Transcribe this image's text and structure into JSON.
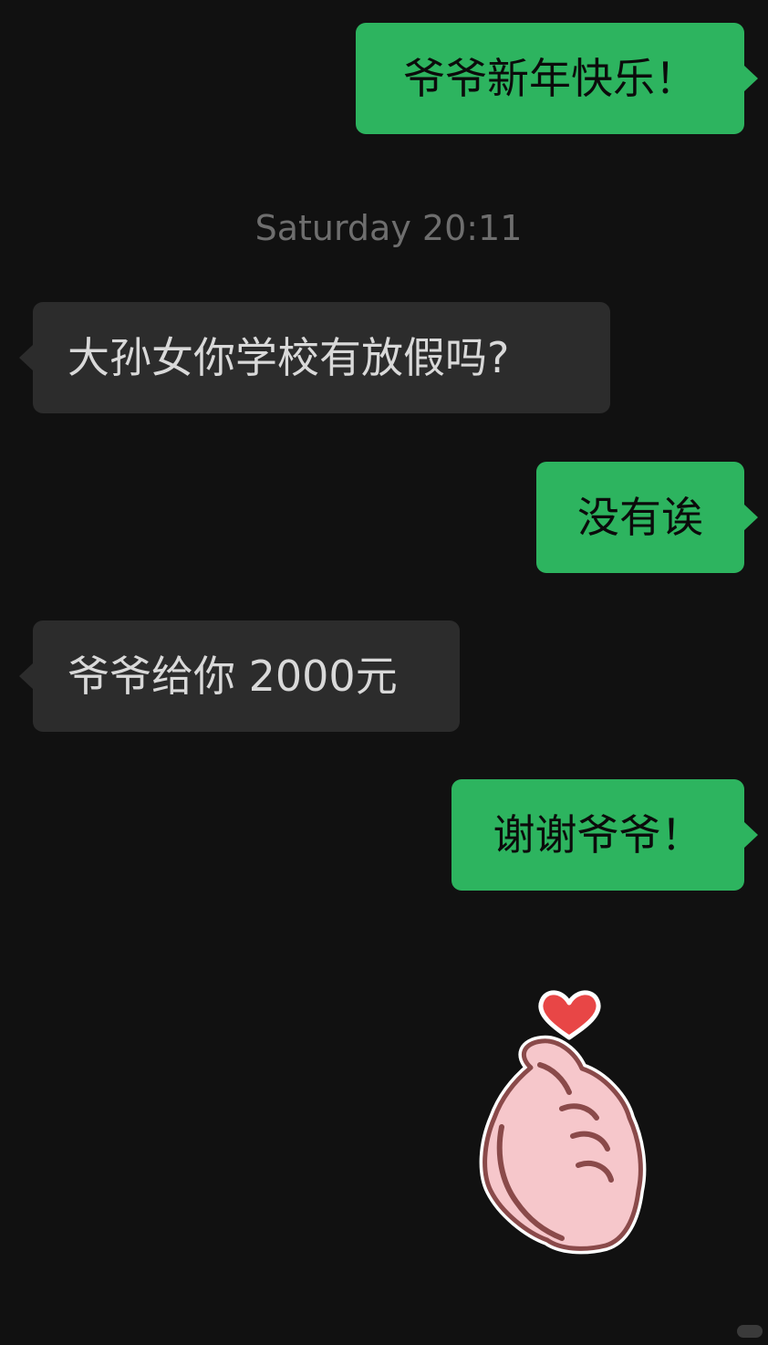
{
  "chat": {
    "timestamp": "Saturday 20:11",
    "messages": [
      {
        "direction": "outgoing",
        "text": "爷爷新年快乐！"
      },
      {
        "direction": "incoming",
        "text": "大孙女你学校有放假吗?"
      },
      {
        "direction": "outgoing",
        "text": "没有诶"
      },
      {
        "direction": "incoming",
        "text": "爷爷给你 2000元"
      },
      {
        "direction": "outgoing",
        "text": "谢谢爷爷！"
      }
    ],
    "sticker": {
      "icon": "finger-heart-icon"
    }
  },
  "colors": {
    "background": "#111111",
    "outgoing_bubble": "#2db45f",
    "incoming_bubble": "#2c2c2c",
    "timestamp_text": "#6e6e6e",
    "heart": "#e84646"
  }
}
